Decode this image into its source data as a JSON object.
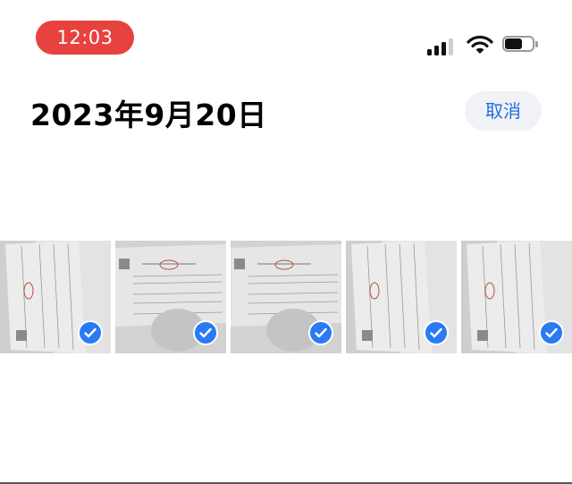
{
  "status_bar": {
    "time": "12:03",
    "time_pill_color": "#e8423f",
    "signal_icon": "cellular-signal-icon",
    "wifi_icon": "wifi-icon",
    "battery_icon": "battery-icon",
    "battery_level": 0.6
  },
  "header": {
    "date_title": "2023年9月20日",
    "cancel_label": "取消",
    "accent_color": "#1e6fe0"
  },
  "photos": [
    {
      "kind": "portrait-document",
      "selected": true,
      "check_icon": "checkmark-circle-icon"
    },
    {
      "kind": "landscape-document",
      "selected": true,
      "check_icon": "checkmark-circle-icon"
    },
    {
      "kind": "landscape-document",
      "selected": true,
      "check_icon": "checkmark-circle-icon"
    },
    {
      "kind": "portrait-document",
      "selected": true,
      "check_icon": "checkmark-circle-icon"
    },
    {
      "kind": "portrait-document",
      "selected": true,
      "check_icon": "checkmark-circle-icon"
    }
  ],
  "selection_color": "#2a7af3"
}
